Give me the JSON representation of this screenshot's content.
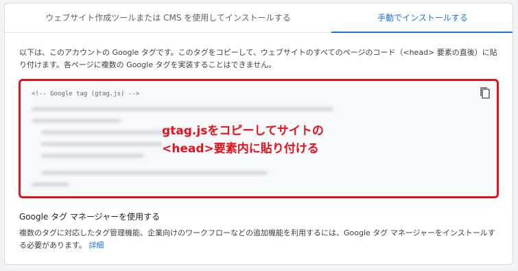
{
  "tabs": {
    "auto_label": "ウェブサイト作成ツールまたは CMS を使用してインストールする",
    "manual_label": "手動でインストールする"
  },
  "intro": "以下は、このアカウントの Google タグです。このタグをコピーして、ウェブサイトのすべてのページのコード（<head> 要素の直後）に貼り付けます。各ページに複数の Google タグを実装することはできません。",
  "code": {
    "first_line": "<!-- Google tag (gtag.js) -->",
    "copy_icon": "copy-icon"
  },
  "annotation": {
    "line1": "gtag.jsをコピーしてサイトの",
    "line2": "<head>要素内に貼り付ける",
    "color": "#e8101a"
  },
  "gtm": {
    "title": "Google タグ マネージャーを使用する",
    "body": "複数のタグに対応したタグ管理機能、企業向けのワークフローなどの追加機能を利用するには、Google タグ マネージャーをインストールする必要があります。",
    "link": "詳細"
  },
  "colors": {
    "accent": "#1a73e8",
    "highlight_border": "#e8101a"
  }
}
